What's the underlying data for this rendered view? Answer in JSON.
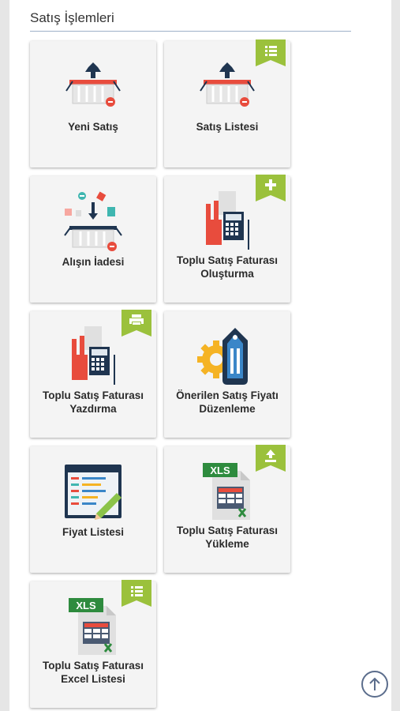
{
  "section": {
    "title": "Satış İşlemleri"
  },
  "tiles": [
    {
      "label": "Yeni Satış",
      "icon": "basket-up-icon",
      "badge": ""
    },
    {
      "label": "Satış Listesi",
      "icon": "basket-up-icon",
      "badge": "list-icon"
    },
    {
      "label": "Alışın İadesi",
      "icon": "basket-return-icon",
      "badge": ""
    },
    {
      "label": "Toplu Satış Faturası Oluşturma",
      "icon": "invoice-calculator-icon",
      "badge": "plus-icon"
    },
    {
      "label": "Toplu Satış Faturası Yazdırma",
      "icon": "invoice-calculator-icon",
      "badge": "print-icon"
    },
    {
      "label": "Önerilen Satış Fiyatı Düzenleme",
      "icon": "gear-tag-icon",
      "badge": ""
    },
    {
      "label": "Fiyat Listesi",
      "icon": "price-list-icon",
      "badge": ""
    },
    {
      "label": "Toplu Satış Faturası Yükleme",
      "icon": "xls-icon",
      "badge": "upload-icon"
    },
    {
      "label": "Toplu Satış Faturası Excel Listesi",
      "icon": "xls-icon",
      "badge": "list-icon"
    }
  ],
  "xls_label": "XLS",
  "colors": {
    "ribbon": "#9bc13c",
    "accent_red": "#e84c3d",
    "navy": "#1f3550"
  }
}
